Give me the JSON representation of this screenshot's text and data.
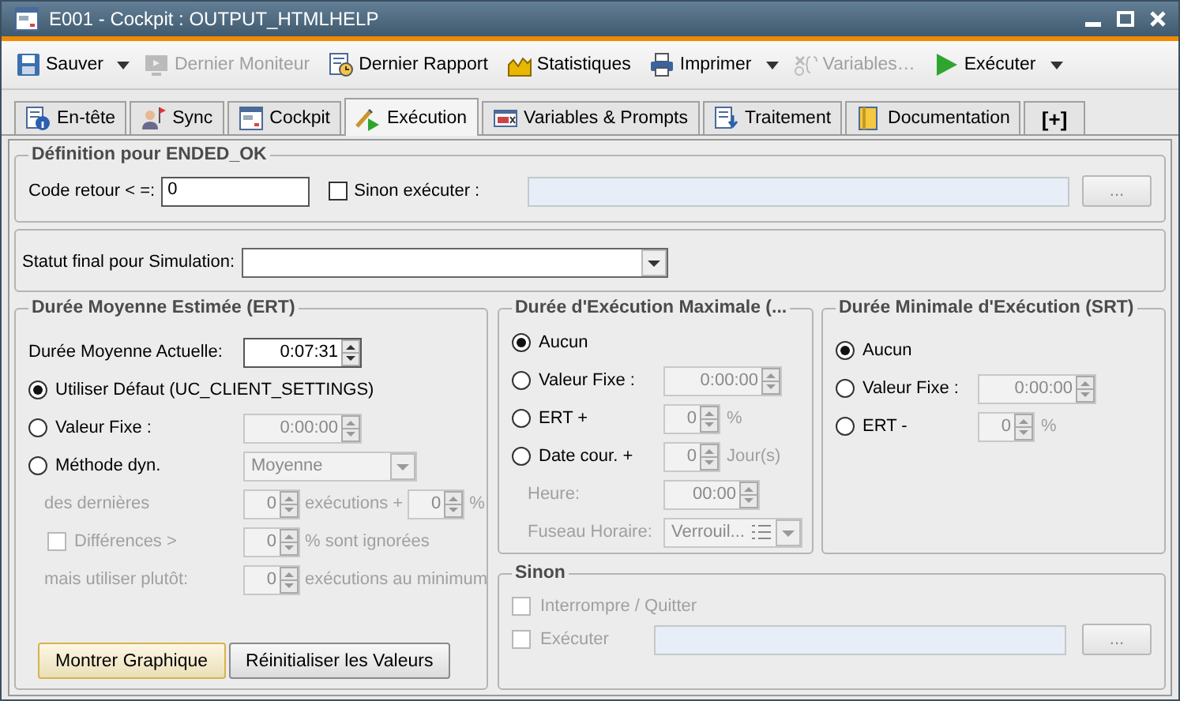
{
  "window": {
    "title": "E001 - Cockpit : OUTPUT_HTMLHELP"
  },
  "toolbar": [
    {
      "label": "Sauver",
      "disabled": false,
      "dropdown": true
    },
    {
      "label": "Dernier Moniteur",
      "disabled": true,
      "dropdown": false
    },
    {
      "label": "Dernier Rapport",
      "disabled": false,
      "dropdown": false
    },
    {
      "label": "Statistiques",
      "disabled": false,
      "dropdown": false
    },
    {
      "label": "Imprimer",
      "disabled": false,
      "dropdown": true
    },
    {
      "label": "Variables…",
      "disabled": true,
      "dropdown": false
    },
    {
      "label": "Exécuter",
      "disabled": false,
      "dropdown": true
    }
  ],
  "tabs": [
    {
      "label": "En-tête",
      "selected": false
    },
    {
      "label": "Sync",
      "selected": false
    },
    {
      "label": "Cockpit",
      "selected": false
    },
    {
      "label": "Exécution",
      "selected": true
    },
    {
      "label": "Variables & Prompts",
      "selected": false
    },
    {
      "label": "Traitement",
      "selected": false
    },
    {
      "label": "Documentation",
      "selected": false
    },
    {
      "label": "[+]",
      "selected": false
    }
  ],
  "definition": {
    "title": "Définition pour ENDED_OK",
    "return_code_label": "Code retour < =:",
    "return_code_value": "0",
    "else_execute": {
      "label": "Sinon exécuter :",
      "checked": false
    },
    "browse_button": "..."
  },
  "simulation": {
    "label": "Statut final pour Simulation:"
  },
  "ert": {
    "title": "Durée Moyenne Estimée (ERT)",
    "rows": [
      {
        "kind": "plain",
        "label": "Durée Moyenne Actuelle:",
        "disabled": false,
        "controls": [
          {
            "kind": "spin",
            "value": "0:07:31",
            "disabled": false
          }
        ]
      },
      {
        "kind": "radio",
        "label": "Utiliser Défaut (UC_CLIENT_SETTINGS)",
        "selected": true,
        "disabled": false
      },
      {
        "kind": "radio",
        "label": "Valeur Fixe :",
        "selected": false,
        "disabled": false,
        "controls": [
          {
            "kind": "spin",
            "value": "0:00:00",
            "disabled": true
          }
        ]
      },
      {
        "kind": "radio",
        "label": "Méthode dyn.",
        "selected": false,
        "disabled": false,
        "controls": [
          {
            "kind": "select",
            "value": "Moyenne",
            "disabled": true
          }
        ]
      },
      {
        "kind": "plain",
        "label": "des dernières",
        "disabled": true,
        "controls": [
          {
            "kind": "spin",
            "value": "0",
            "disabled": true
          },
          {
            "kind": "unit",
            "value": "exécutions +",
            "disabled": true
          },
          {
            "kind": "spin",
            "value": "0",
            "disabled": true
          },
          {
            "kind": "unit",
            "value": "%",
            "disabled": true
          }
        ]
      },
      {
        "kind": "check",
        "label": "Différences >",
        "checked": false,
        "disabled": true,
        "controls": [
          {
            "kind": "spin",
            "value": "0",
            "disabled": true
          },
          {
            "kind": "unit",
            "value": "% sont ignorées",
            "disabled": true
          }
        ]
      },
      {
        "kind": "plain",
        "label": "mais utiliser plutôt:",
        "disabled": true,
        "controls": [
          {
            "kind": "spin",
            "value": "0",
            "disabled": true
          },
          {
            "kind": "unit",
            "value": "exécutions au minimum",
            "disabled": true
          }
        ]
      }
    ],
    "buttons": [
      {
        "label": "Montrer Graphique",
        "focused": true
      },
      {
        "label": "Réinitialiser les Valeurs",
        "focused": false
      }
    ]
  },
  "max_runtime": {
    "title": "Durée d'Exécution Maximale (...",
    "rows": [
      {
        "kind": "radio",
        "label": "Aucun",
        "selected": true,
        "disabled": false
      },
      {
        "kind": "radio",
        "label": "Valeur Fixe :",
        "selected": false,
        "disabled": false,
        "controls": [
          {
            "kind": "spin",
            "value": "0:00:00",
            "disabled": true
          }
        ]
      },
      {
        "kind": "radio",
        "label": "ERT +",
        "selected": false,
        "disabled": false,
        "controls": [
          {
            "kind": "spin",
            "value": "0",
            "disabled": true
          },
          {
            "kind": "unit",
            "value": "%",
            "disabled": true
          }
        ]
      },
      {
        "kind": "radio",
        "label": "Date cour. +",
        "selected": false,
        "disabled": false,
        "controls": [
          {
            "kind": "spin",
            "value": "0",
            "disabled": true
          },
          {
            "kind": "unit",
            "value": "Jour(s)",
            "disabled": true
          }
        ]
      },
      {
        "kind": "plain",
        "label": "Heure:",
        "disabled": true,
        "controls": [
          {
            "kind": "spin",
            "value": "00:00",
            "disabled": true
          }
        ]
      },
      {
        "kind": "plain",
        "label": "Fuseau Horaire:",
        "disabled": true,
        "controls": [
          {
            "kind": "list-select",
            "value": "Verrouil...",
            "disabled": true
          }
        ]
      }
    ]
  },
  "min_runtime": {
    "title": "Durée Minimale d'Exécution (SRT)",
    "rows": [
      {
        "kind": "radio",
        "label": "Aucun",
        "selected": true,
        "disabled": false
      },
      {
        "kind": "radio",
        "label": "Valeur Fixe :",
        "selected": false,
        "disabled": false,
        "controls": [
          {
            "kind": "spin",
            "value": "0:00:00",
            "disabled": true
          }
        ]
      },
      {
        "kind": "radio",
        "label": "ERT -",
        "selected": false,
        "disabled": false,
        "controls": [
          {
            "kind": "spin",
            "value": "0",
            "disabled": true
          },
          {
            "kind": "unit",
            "value": "%",
            "disabled": true
          }
        ]
      }
    ]
  },
  "else": {
    "title": "Sinon",
    "abort": {
      "label": "Interrompre / Quitter",
      "checked": false,
      "disabled": true
    },
    "execute": {
      "label": "Exécuter",
      "checked": false,
      "disabled": true
    },
    "browse_button": "..."
  }
}
